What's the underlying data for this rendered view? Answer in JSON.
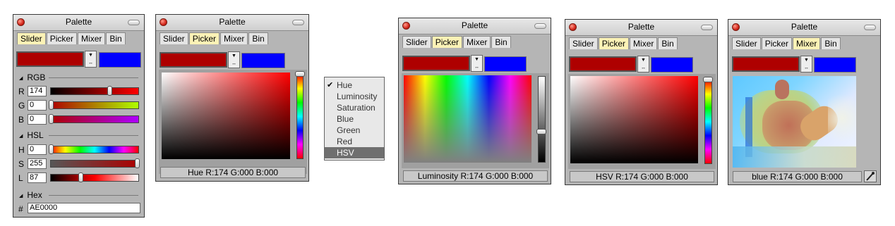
{
  "window_title": "Palette",
  "tabs": [
    "Slider",
    "Picker",
    "Mixer",
    "Bin"
  ],
  "colors": {
    "current": "#ae0000",
    "new": "#0000ff"
  },
  "slider_panel": {
    "rgb_label": "RGB",
    "r_label": "R",
    "r_value": "174",
    "g_label": "G",
    "g_value": "0",
    "b_label": "B",
    "b_value": "0",
    "hsl_label": "HSL",
    "h_label": "H",
    "h_value": "0",
    "s_label": "S",
    "s_value": "255",
    "l_label": "L",
    "l_value": "87",
    "hex_label": "Hex",
    "hex_prefix": "#",
    "hex_value": "AE0000"
  },
  "picker_hue": {
    "status": "Hue R:174 G:000 B:000"
  },
  "menu": {
    "items": [
      "Hue",
      "Luminosity",
      "Saturation",
      "Blue",
      "Green",
      "Red",
      "HSV"
    ],
    "checked": "Hue",
    "highlighted": "HSV",
    "check_mark": "✔"
  },
  "picker_luminosity": {
    "status": "Luminosity R:174 G:000 B:000"
  },
  "picker_hsv": {
    "status": "HSV R:174 G:000 B:000"
  },
  "mixer": {
    "status": "blue R:174 G:000 B:000"
  }
}
